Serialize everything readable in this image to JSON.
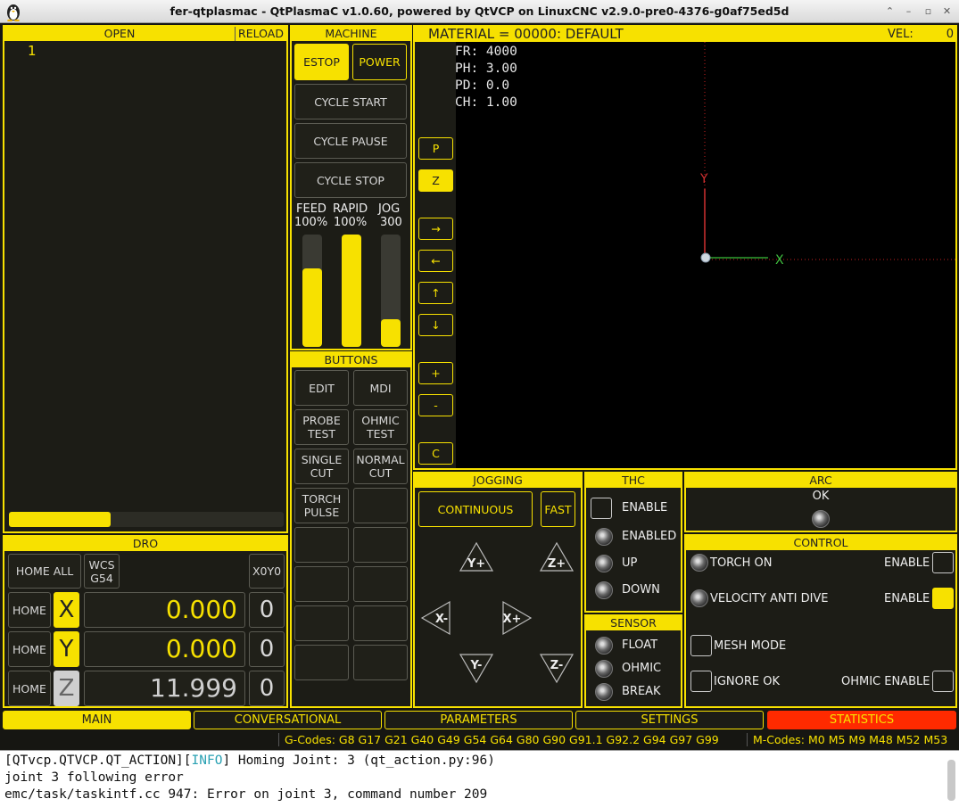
{
  "window": {
    "title": "fer-qtplasmac - QtPlasmaC v1.0.60, powered by QtVCP on LinuxCNC v2.9.0-pre0-4376-g0af75ed5d"
  },
  "gcode_panel": {
    "open_label": "OPEN",
    "reload_label": "RELOAD",
    "line_number": "1"
  },
  "machine": {
    "header": "MACHINE",
    "estop": "ESTOP",
    "power": "POWER",
    "cycle_start": "CYCLE START",
    "cycle_pause": "CYCLE PAUSE",
    "cycle_stop": "CYCLE STOP",
    "feed_label": "FEED",
    "feed_value": "100%",
    "rapid_label": "RAPID",
    "rapid_value": "100%",
    "jog_label": "JOG",
    "jog_value": "300",
    "feed_level": 0.7,
    "rapid_level": 1.0,
    "jog_level": 0.25
  },
  "buttons": {
    "header": "BUTTONS",
    "edit": "EDIT",
    "mdi": "MDI",
    "probe_test_1": "PROBE",
    "probe_test_2": "TEST",
    "ohmic_test_1": "OHMIC",
    "ohmic_test_2": "TEST",
    "single_cut_1": "SINGLE",
    "single_cut_2": "CUT",
    "normal_cut_1": "NORMAL",
    "normal_cut_2": "CUT",
    "torch_pulse_1": "TORCH",
    "torch_pulse_2": "PULSE"
  },
  "preview": {
    "material": "MATERIAL = 00000: DEFAULT",
    "vel_label": "VEL:",
    "vel_value": "0",
    "fr": "FR: 4000",
    "ph": "PH: 3.00",
    "pd": "PD: 0.0",
    "ch": "CH: 1.00",
    "axis_y": "Y",
    "axis_x": "X",
    "view_p": "P",
    "view_z": "Z",
    "pan_right": "→",
    "pan_left": "←",
    "pan_up": "↑",
    "pan_down": "↓",
    "zoom_in": "+",
    "zoom_out": "-",
    "clear": "C"
  },
  "dro": {
    "header": "DRO",
    "home_all": "HOME ALL",
    "wcs_1": "WCS",
    "wcs_2": "G54",
    "x0y0": "X0Y0",
    "home": "HOME",
    "x_axis": "X",
    "x_value": "0.000",
    "y_axis": "Y",
    "y_value": "0.000",
    "z_axis": "Z",
    "z_value": "11.999",
    "zero": "0"
  },
  "jogging": {
    "header": "JOGGING",
    "continuous": "CONTINUOUS",
    "fast": "FAST",
    "y_plus": "Y+",
    "z_plus": "Z+",
    "x_minus": "X-",
    "x_plus": "X+",
    "y_minus": "Y-",
    "z_minus": "Z-"
  },
  "thc": {
    "header": "THC",
    "enable": "ENABLE",
    "enabled": "ENABLED",
    "up": "UP",
    "down": "DOWN"
  },
  "sensor": {
    "header": "SENSOR",
    "float": "FLOAT",
    "ohmic": "OHMIC",
    "break": "BREAK"
  },
  "arc": {
    "header": "ARC",
    "ok": "OK"
  },
  "control": {
    "header": "CONTROL",
    "torch_on": "TORCH ON",
    "enable": "ENABLE",
    "velocity_anti_dive": "VELOCITY ANTI DIVE",
    "mesh_mode": "MESH MODE",
    "ignore_ok": "IGNORE OK",
    "ohmic_enable": "OHMIC ENABLE"
  },
  "tabs": {
    "main": "MAIN",
    "conversational": "CONVERSATIONAL",
    "parameters": "PARAMETERS",
    "settings": "SETTINGS",
    "statistics": "STATISTICS"
  },
  "status": {
    "gcodes": "G-Codes: G8 G17 G21 G40 G49 G54 G64 G80 G90 G91.1 G92.2 G94 G97 G99",
    "mcodes": "M-Codes: M0 M5 M9 M48 M52 M53"
  },
  "console": {
    "line1_prefix": "[QTvcp.QTVCP.QT_ACTION][",
    "line1_info": "INFO",
    "line1_rest": "]  Homing Joint: 3 (qt_action.py:96)",
    "line2": "joint 3 following error",
    "line3": "emc/task/taskintf.cc 947: Error on joint 3, command number 209"
  },
  "colors": {
    "accent": "#f7e100",
    "statistics": "#ff2a00",
    "info": "#2aa1b3"
  }
}
